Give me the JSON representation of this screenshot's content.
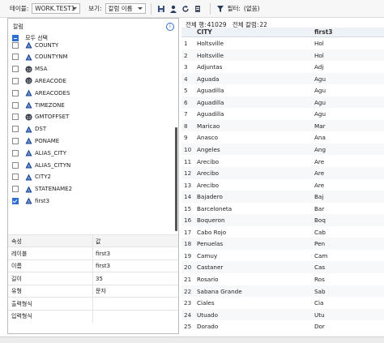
{
  "toolbar": {
    "table_label": "테이블:",
    "table_value": "WORK.TEST1",
    "view_label": "보기:",
    "view_value": "칼럼 이름",
    "filter_label": "필터:",
    "filter_value": "(없음)",
    "icons": [
      "save-icon",
      "user-icon",
      "refresh-icon",
      "export-icon",
      "filter-icon"
    ]
  },
  "counts": {
    "total_rows_label": "전체 행:",
    "total_rows": "41029",
    "total_cols_label": "전체 칼럼:",
    "total_cols": "22"
  },
  "columns_panel": {
    "title": "칼럼",
    "select_all": "모두 선택",
    "items": [
      {
        "name": "COUNTY",
        "type": "char",
        "checked": false
      },
      {
        "name": "COUNTYNM",
        "type": "char",
        "checked": false
      },
      {
        "name": "MSA",
        "type": "num",
        "checked": false
      },
      {
        "name": "AREACODE",
        "type": "num",
        "checked": false
      },
      {
        "name": "AREACODES",
        "type": "char",
        "checked": false
      },
      {
        "name": "TIMEZONE",
        "type": "char",
        "checked": false
      },
      {
        "name": "GMTOFFSET",
        "type": "num",
        "checked": false
      },
      {
        "name": "DST",
        "type": "char",
        "checked": false
      },
      {
        "name": "PONAME",
        "type": "char",
        "checked": false
      },
      {
        "name": "ALIAS_CITY",
        "type": "char",
        "checked": false
      },
      {
        "name": "ALIAS_CITYN",
        "type": "char",
        "checked": false
      },
      {
        "name": "CITY2",
        "type": "char",
        "checked": false
      },
      {
        "name": "STATENAME2",
        "type": "char",
        "checked": false
      },
      {
        "name": "first3",
        "type": "char",
        "checked": true
      }
    ]
  },
  "properties": {
    "header_key": "속성",
    "header_val": "값",
    "rows": [
      {
        "key": "레이블",
        "value": "first3"
      },
      {
        "key": "이름",
        "value": "first3"
      },
      {
        "key": "길이",
        "value": "35"
      },
      {
        "key": "유형",
        "value": "문자"
      },
      {
        "key": "출력형식",
        "value": ""
      },
      {
        "key": "입력형식",
        "value": ""
      }
    ]
  },
  "grid": {
    "headers": [
      "CITY",
      "first3"
    ],
    "rows": [
      {
        "n": "1",
        "city": "Holtsville",
        "first3": "Hol"
      },
      {
        "n": "2",
        "city": "Holtsville",
        "first3": "Hol"
      },
      {
        "n": "3",
        "city": "Adjuntas",
        "first3": "Adj"
      },
      {
        "n": "4",
        "city": "Aguada",
        "first3": "Agu"
      },
      {
        "n": "5",
        "city": "Aguadilla",
        "first3": "Agu"
      },
      {
        "n": "6",
        "city": "Aguadilla",
        "first3": "Agu"
      },
      {
        "n": "7",
        "city": "Aguadilla",
        "first3": "Agu"
      },
      {
        "n": "8",
        "city": "Maricao",
        "first3": "Mar"
      },
      {
        "n": "9",
        "city": "Anasco",
        "first3": "Ana"
      },
      {
        "n": "10",
        "city": "Angeles",
        "first3": "Ang"
      },
      {
        "n": "11",
        "city": "Arecibo",
        "first3": "Are"
      },
      {
        "n": "12",
        "city": "Arecibo",
        "first3": "Are"
      },
      {
        "n": "13",
        "city": "Arecibo",
        "first3": "Are"
      },
      {
        "n": "14",
        "city": "Bajadero",
        "first3": "Baj"
      },
      {
        "n": "15",
        "city": "Barceloneta",
        "first3": "Bar"
      },
      {
        "n": "16",
        "city": "Boqueron",
        "first3": "Boq"
      },
      {
        "n": "17",
        "city": "Cabo Rojo",
        "first3": "Cab"
      },
      {
        "n": "18",
        "city": "Penuelas",
        "first3": "Pen"
      },
      {
        "n": "19",
        "city": "Camuy",
        "first3": "Cam"
      },
      {
        "n": "20",
        "city": "Castaner",
        "first3": "Cas"
      },
      {
        "n": "21",
        "city": "Rosario",
        "first3": "Ros"
      },
      {
        "n": "22",
        "city": "Sabana Grande",
        "first3": "Sab"
      },
      {
        "n": "23",
        "city": "Ciales",
        "first3": "Cia"
      },
      {
        "n": "24",
        "city": "Utuado",
        "first3": "Utu"
      },
      {
        "n": "25",
        "city": "Dorado",
        "first3": "Dor"
      }
    ]
  },
  "colors": {
    "accent": "#2f6fd0",
    "char_icon": "#1f4e9c",
    "num_icon": "#3a3f4a"
  }
}
